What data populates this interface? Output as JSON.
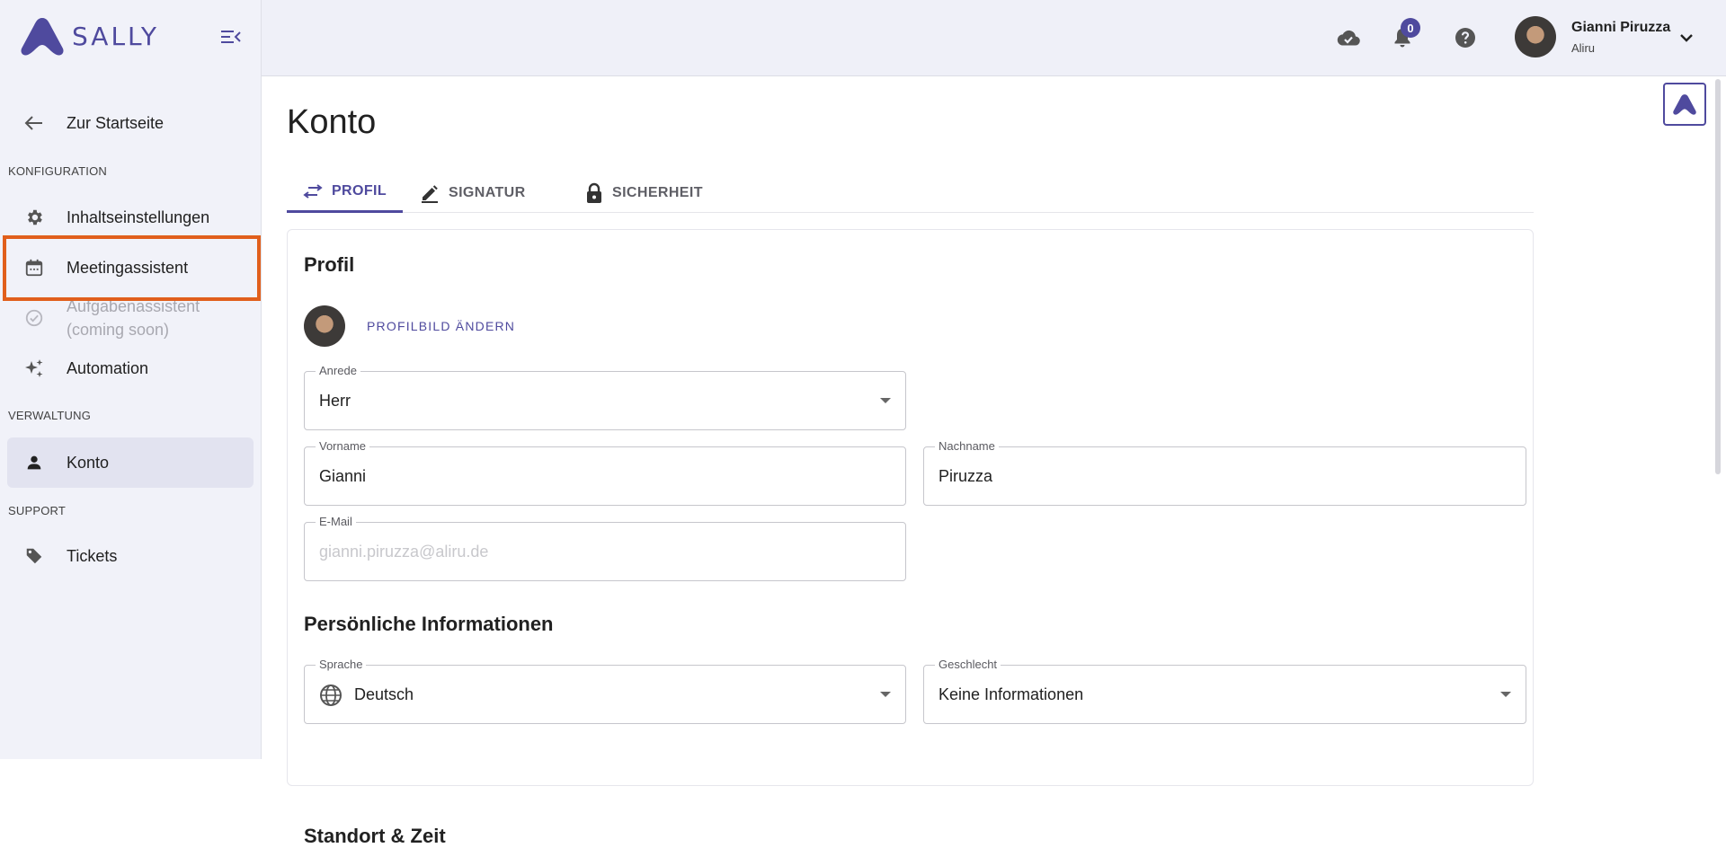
{
  "app": {
    "logo_text": "SALLY"
  },
  "sidebar": {
    "back_label": "Zur Startseite",
    "sections": {
      "konfiguration": "KONFIGURATION",
      "verwaltung": "VERWALTUNG",
      "support": "SUPPORT"
    },
    "items": {
      "inhalt": "Inhaltseinstellungen",
      "meeting": "Meetingassistent",
      "aufgaben_line1": "Aufgabenassistent",
      "aufgaben_line2": "(coming soon)",
      "automation": "Automation",
      "konto": "Konto",
      "tickets": "Tickets"
    }
  },
  "topbar": {
    "notification_count": "0",
    "user_name": "Gianni Piruzza",
    "user_org": "Aliru"
  },
  "main": {
    "title": "Konto",
    "tabs": {
      "profil": "PROFIL",
      "signatur": "SIGNATUR",
      "sicherheit": "SICHERHEIT"
    },
    "card": {
      "title": "Profil",
      "change_picture": "PROFILBILD ÄNDERN",
      "fields": {
        "anrede": {
          "label": "Anrede",
          "value": "Herr"
        },
        "vorname": {
          "label": "Vorname",
          "value": "Gianni"
        },
        "nachname": {
          "label": "Nachname",
          "value": "Piruzza"
        },
        "email": {
          "label": "E-Mail",
          "value": "gianni.piruzza@aliru.de"
        },
        "sprache": {
          "label": "Sprache",
          "value": "Deutsch"
        },
        "geschlecht": {
          "label": "Geschlecht",
          "value": "Keine Informationen"
        }
      },
      "personal_title": "Persönliche Informationen",
      "next_section_partial": "Standort & Zeit"
    }
  },
  "colors": {
    "accent": "#4f4a9e",
    "highlight": "#e15f1c"
  }
}
